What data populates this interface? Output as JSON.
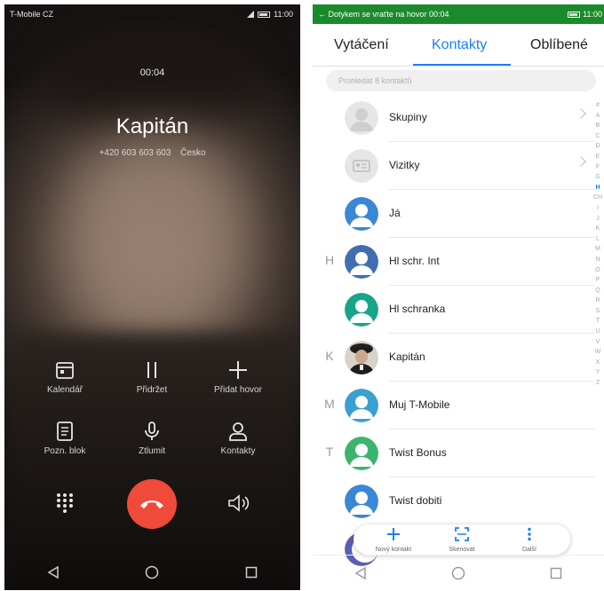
{
  "call_screen": {
    "status": {
      "carrier": "T-Mobile CZ",
      "time": "11:00"
    },
    "timer": "00:04",
    "contact_name": "Kapitán",
    "number": "+420 603 603 603",
    "country": "Česko",
    "actions": [
      {
        "label": "Kalendář",
        "icon": "calendar-icon"
      },
      {
        "label": "Přidržet",
        "icon": "hold-icon"
      },
      {
        "label": "Přidat hovor",
        "icon": "plus-icon"
      },
      {
        "label": "Pozn. blok",
        "icon": "notepad-icon"
      },
      {
        "label": "Ztlumit",
        "icon": "microphone-icon"
      },
      {
        "label": "Kontakty",
        "icon": "person-icon"
      }
    ],
    "end_call_color": "#f04a3a"
  },
  "contacts_screen": {
    "status": {
      "banner": "Dotykem se vraťte na hovor 00:04",
      "time": "11:00",
      "banner_color": "#1a8a2a"
    },
    "tabs": [
      "Vytáčení",
      "Kontakty",
      "Oblíbené"
    ],
    "active_tab": "Kontakty",
    "search_placeholder": "Prohledat 8 kontaktů",
    "rows": [
      {
        "letter": "",
        "name": "Skupiny",
        "avatar": "group",
        "chevron": true
      },
      {
        "letter": "",
        "name": "Vizitky",
        "avatar": "card",
        "chevron": true
      },
      {
        "letter": "",
        "name": "Já",
        "avatar": "blue",
        "chevron": false
      },
      {
        "letter": "H",
        "name": "Hl schr. Int",
        "avatar": "blue",
        "chevron": false
      },
      {
        "letter": "",
        "name": "Hl schranka",
        "avatar": "teal",
        "chevron": false
      },
      {
        "letter": "K",
        "name": "Kapitán",
        "avatar": "photo",
        "chevron": false
      },
      {
        "letter": "M",
        "name": "Muj T-Mobile",
        "avatar": "blue",
        "chevron": false
      },
      {
        "letter": "T",
        "name": "Twist Bonus",
        "avatar": "green",
        "chevron": false
      },
      {
        "letter": "",
        "name": "Twist dobiti",
        "avatar": "blue",
        "chevron": false
      }
    ],
    "alphabet": [
      "#",
      "A",
      "B",
      "C",
      "D",
      "E",
      "F",
      "G",
      "H",
      "CH",
      "I",
      "J",
      "K",
      "L",
      "M",
      "N",
      "O",
      "P",
      "Q",
      "R",
      "S",
      "T",
      "U",
      "V",
      "W",
      "X",
      "Y",
      "Z"
    ],
    "alphabet_selected": "H",
    "fab": [
      {
        "label": "Nový kontakt",
        "icon": "plus-icon"
      },
      {
        "label": "Skenovat",
        "icon": "scan-icon"
      },
      {
        "label": "Další",
        "icon": "more-icon"
      }
    ],
    "accent": "#1e7ef5"
  }
}
